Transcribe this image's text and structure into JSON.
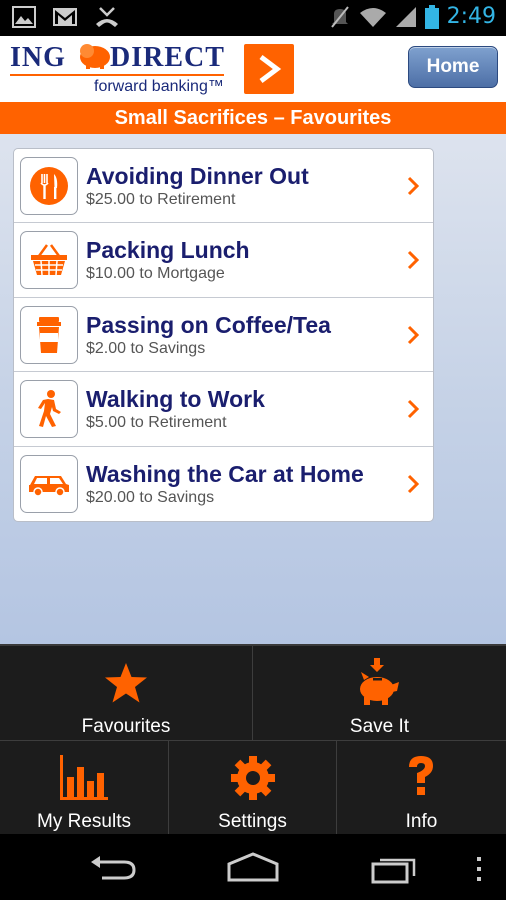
{
  "status_bar": {
    "time": "2:49",
    "icons": [
      "image-icon",
      "gmail-icon",
      "missed-call-icon",
      "mute-icon",
      "wifi-icon",
      "signal-icon",
      "battery-icon"
    ]
  },
  "header": {
    "logo_ing": "ING",
    "logo_direct": "DIRECT",
    "logo_tagline": "forward banking™",
    "home_label": "Home"
  },
  "title_bar": {
    "title": "Small Sacrifices – Favourites"
  },
  "favourites": [
    {
      "title": "Avoiding Dinner Out",
      "subtitle": "$25.00 to Retirement",
      "icon": "cutlery-icon"
    },
    {
      "title": "Packing Lunch",
      "subtitle": "$10.00 to Mortgage",
      "icon": "basket-icon"
    },
    {
      "title": "Passing on Coffee/Tea",
      "subtitle": "$2.00 to Savings",
      "icon": "coffee-cup-icon"
    },
    {
      "title": "Walking to Work",
      "subtitle": "$5.00 to Retirement",
      "icon": "walking-icon"
    },
    {
      "title": "Washing the Car at Home",
      "subtitle": "$20.00 to Savings",
      "icon": "car-icon"
    }
  ],
  "bottom_nav": {
    "favourites": "Favourites",
    "save_it": "Save It",
    "my_results": "My Results",
    "settings": "Settings",
    "info": "Info"
  },
  "colors": {
    "accent_orange": "#ff6200",
    "ing_navy": "#1a2a7a",
    "title_text": "#1a1e6e",
    "time_blue": "#33b5e5"
  }
}
